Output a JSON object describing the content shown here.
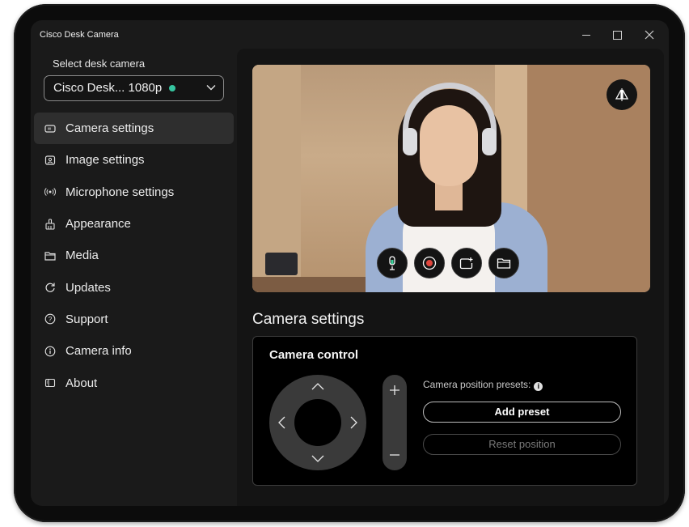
{
  "app": {
    "title": "Cisco Desk Camera"
  },
  "window_controls": {
    "minimize": "minimize-icon",
    "maximize": "maximize-icon",
    "close": "close-icon"
  },
  "sidebar": {
    "select_label": "Select desk camera",
    "selected_camera": "Cisco Desk... 1080p",
    "status_color": "#36c5a0",
    "items": [
      {
        "label": "Camera settings",
        "icon": "camera-settings-icon",
        "active": true
      },
      {
        "label": "Image settings",
        "icon": "image-icon",
        "active": false
      },
      {
        "label": "Microphone settings",
        "icon": "microphone-signal-icon",
        "active": false
      },
      {
        "label": "Appearance",
        "icon": "brush-icon",
        "active": false
      },
      {
        "label": "Media",
        "icon": "folder-icon",
        "active": false
      },
      {
        "label": "Updates",
        "icon": "refresh-icon",
        "active": false
      },
      {
        "label": "Support",
        "icon": "help-icon",
        "active": false
      },
      {
        "label": "Camera info",
        "icon": "info-icon",
        "active": false
      },
      {
        "label": "About",
        "icon": "about-icon",
        "active": false
      }
    ]
  },
  "preview": {
    "controls": [
      "microphone-icon",
      "record-icon",
      "snapshot-icon",
      "folder-icon"
    ],
    "mirror_icon": "mirror-flip-icon"
  },
  "main": {
    "section_title": "Camera settings",
    "camera_control": {
      "title": "Camera control",
      "presets_label": "Camera position presets:",
      "add_preset": "Add preset",
      "reset_position": "Reset position"
    }
  },
  "colors": {
    "accent_status": "#36c5a0",
    "background": "#1a1a1a",
    "panel": "#000000"
  }
}
